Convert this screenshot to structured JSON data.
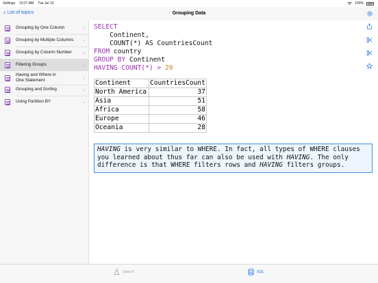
{
  "status_bar": {
    "carrier": "Settings",
    "time": "10:27 AM",
    "date": "Tue Jul 13",
    "battery": "100%"
  },
  "header": {
    "back_label": "List of topics",
    "title": "Grouping Data"
  },
  "sidebar": {
    "items": [
      {
        "label": "Grouping by One Column"
      },
      {
        "label": "Grouping by Multiple Columns"
      },
      {
        "label": "Grouping by Column Number"
      },
      {
        "label": "Filtering Groups"
      },
      {
        "label": "Having and Where in One Statement"
      },
      {
        "label": "Grouping and Sorting"
      },
      {
        "label": "Using Partition BY"
      }
    ],
    "active_index": 3
  },
  "sql": {
    "lines": [
      {
        "kw": "SELECT",
        "rest": ""
      },
      {
        "kw": "",
        "rest": "    Continent,"
      },
      {
        "kw": "",
        "rest": "    COUNT(*) AS CountriesCount"
      },
      {
        "kw": "FROM",
        "rest": " country"
      },
      {
        "kw": "GROUP BY",
        "rest": " Continent"
      },
      {
        "kw": "HAVING COUNT(*) >",
        "rest": " 20"
      }
    ]
  },
  "result_table": {
    "headers": [
      "Continent",
      "CountriesCount"
    ],
    "rows": [
      [
        "North America",
        "37"
      ],
      [
        "Asia",
        "51"
      ],
      [
        "Africa",
        "58"
      ],
      [
        "Europe",
        "46"
      ],
      [
        "Oceania",
        "28"
      ]
    ]
  },
  "note": {
    "w1": "HAVING",
    "t1": " is very similar to WHERE. In fact, all types of WHERE clauses you learned about thus far can also be used with ",
    "w2": "HAVING",
    "t2": ". The only difference is that WHERE filters rows and ",
    "w3": "HAVING",
    "t3": " filters groups."
  },
  "tabs": [
    {
      "label": "Java 8",
      "icon": "flask-icon",
      "active": false
    },
    {
      "label": "SQL",
      "icon": "database-icon",
      "active": true
    }
  ],
  "toolbar_icons": [
    "share-icon",
    "scissors-icon",
    "scissors-alt-icon",
    "star-icon"
  ],
  "colors": {
    "accent": "#1e6fdc",
    "keyword": "#9a2fb0",
    "number": "#c8841a",
    "note_border": "#3d8fe0"
  }
}
